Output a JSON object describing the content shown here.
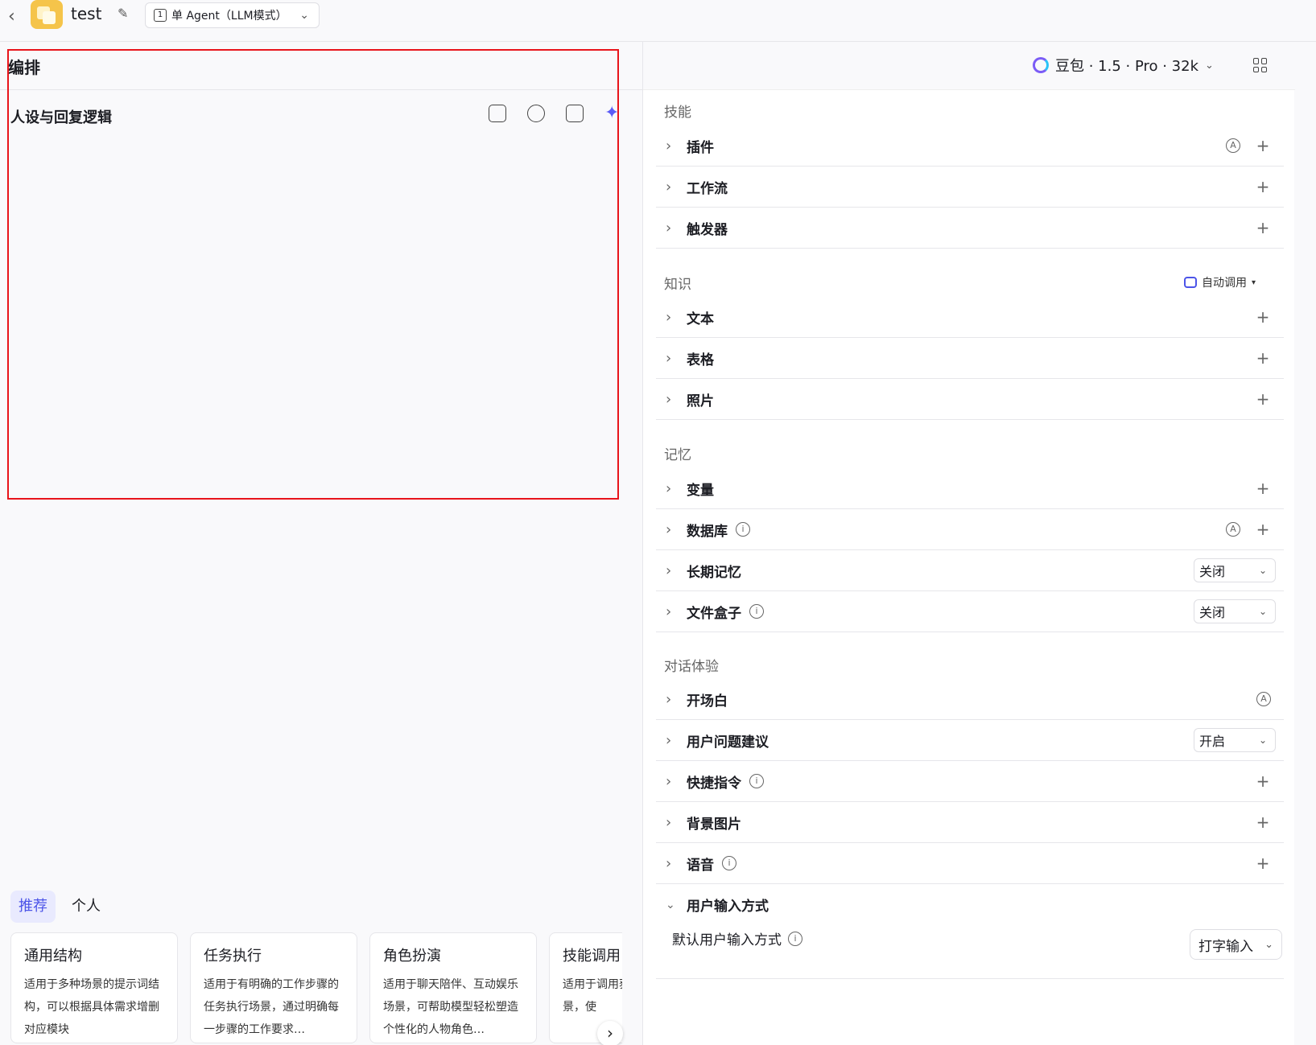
{
  "header": {
    "app_name": "test",
    "mode_label": "单 Agent（LLM模式）"
  },
  "left": {
    "title": "编排",
    "section_title": "人设与回复逻辑",
    "tabs": [
      "推荐",
      "个人"
    ],
    "cards": [
      {
        "title": "通用结构",
        "desc": "适用于多种场景的提示词结构，可以根据具体需求增删对应模块"
      },
      {
        "title": "任务执行",
        "desc": "适用于有明确的工作步骤的任务执行场景，通过明确每一步骤的工作要求…"
      },
      {
        "title": "角色扮演",
        "desc": "适用于聊天陪伴、互动娱乐场景，可帮助模型轻松塑造个性化的人物角色…"
      },
      {
        "title": "技能调用",
        "desc": "适用于调用获取信息的场景，使"
      }
    ]
  },
  "right": {
    "model_label": "豆包 · 1.5 · Pro · 32k",
    "groups": {
      "skills": "技能",
      "knowledge": "知识",
      "memory": "记忆",
      "dialogue": "对话体验"
    },
    "knowledge_auto": "自动调用",
    "rows": {
      "plugin": "插件",
      "workflow": "工作流",
      "trigger": "触发器",
      "text": "文本",
      "table": "表格",
      "photo": "照片",
      "variable": "变量",
      "database": "数据库",
      "long_memory": "长期记忆",
      "filebox": "文件盒子",
      "opening": "开场白",
      "suggestion": "用户问题建议",
      "shortcut": "快捷指令",
      "background": "背景图片",
      "voice": "语音",
      "input_mode": "用户输入方式"
    },
    "long_memory_value": "关闭",
    "filebox_value": "关闭",
    "suggestion_value": "开启",
    "default_input_label": "默认用户输入方式",
    "default_input_value": "打字输入"
  }
}
